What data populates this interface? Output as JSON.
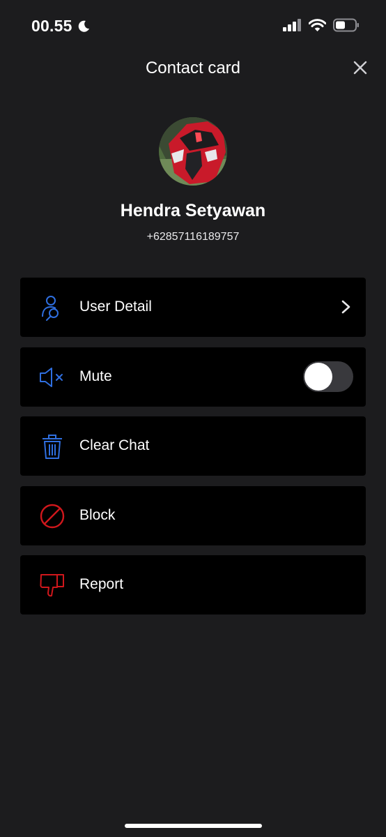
{
  "status_bar": {
    "time": "00.55",
    "icons": [
      "moon-icon",
      "cellular-signal-icon",
      "wifi-icon",
      "battery-icon"
    ]
  },
  "header": {
    "title": "Contact card",
    "close_icon": "close-icon"
  },
  "contact": {
    "name": "Hendra Setyawan",
    "phone": "+62857116189757"
  },
  "menu": {
    "items": [
      {
        "label": "User Detail",
        "icon": "user-search-icon",
        "trailing": "chevron-right-icon",
        "color": "#2f6fe0"
      },
      {
        "label": "Mute",
        "icon": "speaker-muted-icon",
        "trailing": "toggle",
        "toggle_on": false,
        "color": "#2f6fe0"
      },
      {
        "label": "Clear Chat",
        "icon": "trash-icon",
        "color": "#2f6fe0"
      },
      {
        "label": "Block",
        "icon": "block-icon",
        "color": "#d0171c"
      },
      {
        "label": "Report",
        "icon": "thumbs-down-icon",
        "color": "#d0171c"
      }
    ]
  }
}
